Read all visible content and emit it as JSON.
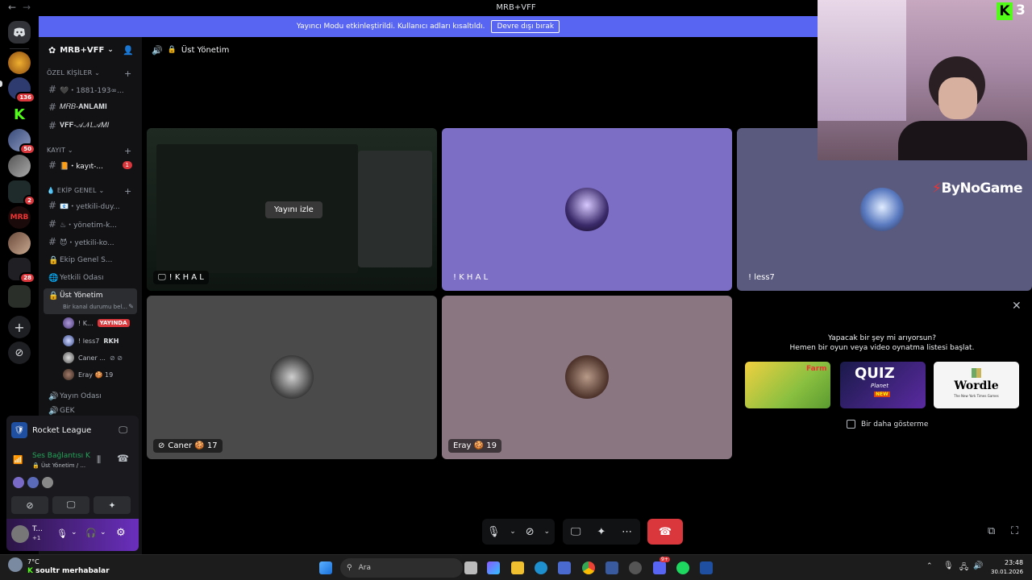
{
  "titlebar": {
    "title": "MRB+VFF"
  },
  "banner": {
    "message": "Yayıncı Modu etkinleştirildi. Kullanıcı adları kısaltıldı.",
    "button": "Devre dışı bırak"
  },
  "rail": {
    "badges": [
      "136",
      "50",
      "2",
      "28"
    ]
  },
  "sidebar": {
    "server_name": "MRB+VFF",
    "categories": {
      "ozel": "ÖZEL KİŞİLER",
      "kayit": "KAYIT",
      "ekip": "EKİP GENEL"
    },
    "channels": {
      "c1": "🖤・1881-193∞...",
      "c2": "𝑀𝑅𝐵-𝐀𝐍𝐋𝐀𝐌𝐈",
      "c3": "𝐕𝐅𝐅-𝒜𝒩𝐿𝒜𝑀𝐼",
      "c4": "📙・kayıt-...",
      "c4_badge": "1",
      "c5": "📧・yetkili-duy...",
      "c6": "♨・yönetim-k...",
      "c7": "😈・yetkili-ko...",
      "c8": "Ekip Genel S...",
      "c9": "Yetkili Odası",
      "c10": "Üst Yönetim",
      "c10_status": "Bir kanal durumu bel...",
      "c11": "Yayın Odası",
      "c12": "GEK"
    },
    "voice_users": [
      {
        "name": "! K...",
        "extra": "YAYINDA"
      },
      {
        "name": "! less7",
        "extra": "RKH"
      },
      {
        "name": "Caner ...",
        "extra": ""
      },
      {
        "name": "Eray 🍪 19",
        "extra": ""
      }
    ]
  },
  "activity": {
    "game": "Rocket League"
  },
  "voice_panel": {
    "status": "Ses Bağlantısı K",
    "location": "Üst Yönetim / ..."
  },
  "userbar": {
    "name": "T...",
    "sub": "+1"
  },
  "channel_header": {
    "title": "Üst Yönetim"
  },
  "tiles": {
    "stream_overlay": "Yayını izle",
    "t1": "! K H A L",
    "t2": "! K H A L",
    "t3": "! less7",
    "t4": "Caner 🍪 17",
    "t5": "Eray 🍪 19"
  },
  "activity_panel": {
    "line1": "Yapacak bir şey mi arıyorsun?",
    "line2": "Hemen bir oyun veya video oynatma listesi başlat.",
    "games": [
      "Farm",
      "QUIZ",
      "Wordle"
    ],
    "game_sub": {
      "quiz": "Planet",
      "quiz_new": "NEW",
      "wordle": "The New York Times Games"
    },
    "checkbox": "Bir daha gösterme"
  },
  "overlay": {
    "kick_count": "3",
    "brand": "ByNoGame"
  },
  "taskbar": {
    "weather_temp": "7°C",
    "ticker_user": "soultr",
    "ticker_msg": "merhabalar",
    "search": "Ara",
    "time": "23:48",
    "date": "30.01.2026",
    "discord_badge": "9+"
  },
  "colors": {
    "accent": "#5865f2",
    "tile_purple": "#7c6dc5",
    "tile_blue": "#5a5a7e",
    "tile_gray": "#4a4a4a",
    "tile_mauve": "#8a7680",
    "danger": "#da373c",
    "kick_green": "#53fc18"
  }
}
